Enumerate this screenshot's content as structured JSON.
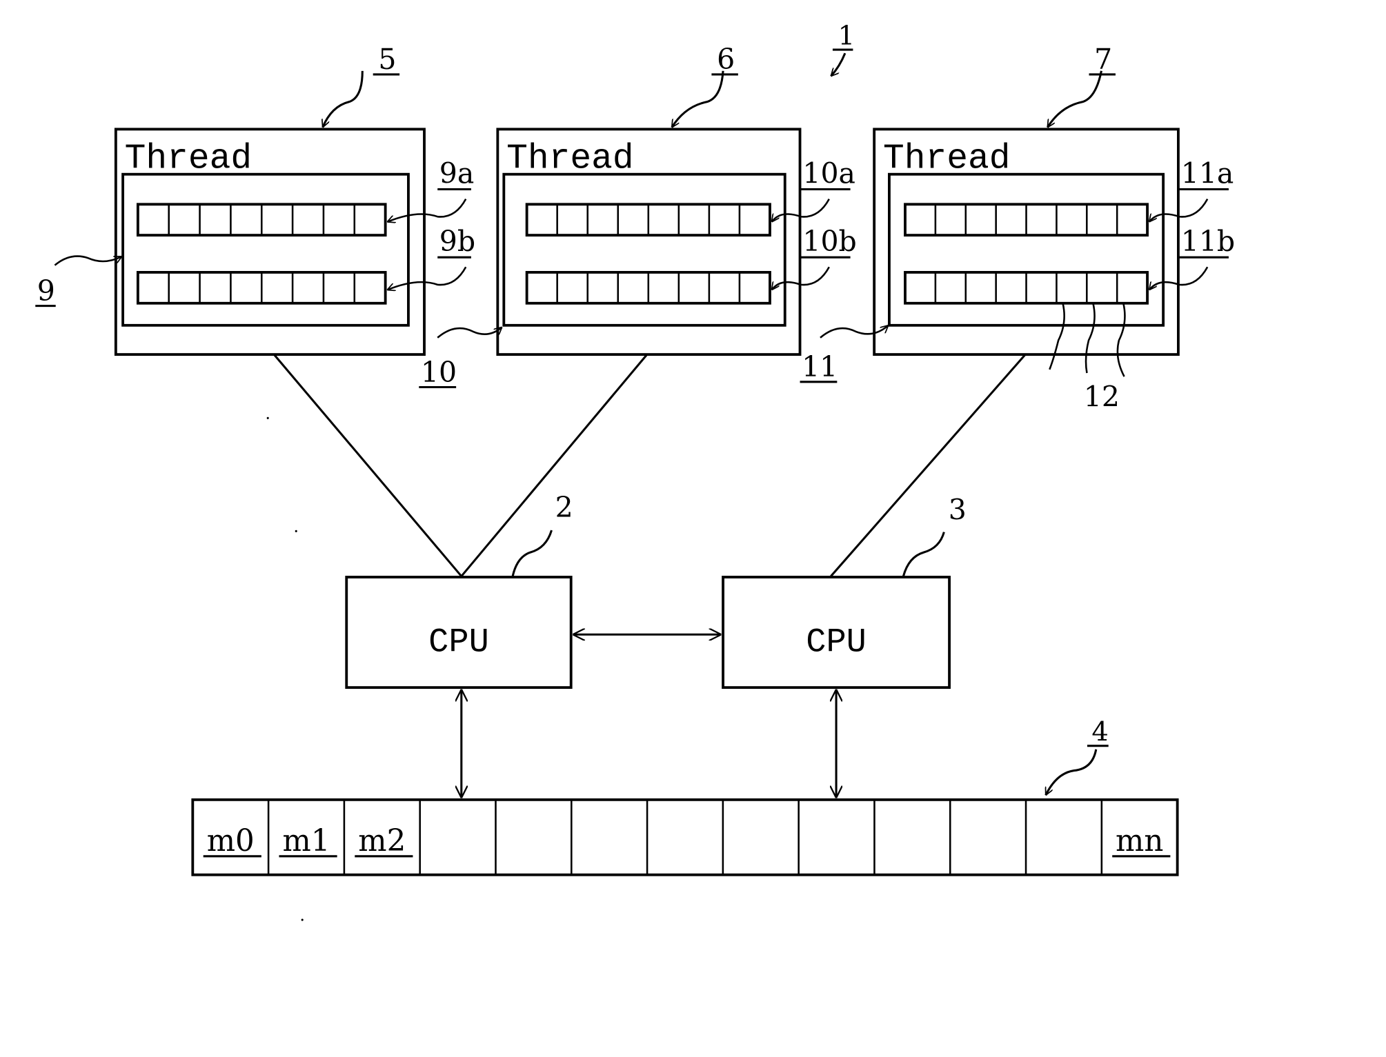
{
  "diagram": {
    "system_ref": "1",
    "threads": [
      {
        "ref": "5",
        "title": "Thread",
        "register_set_ref": "9",
        "rows": [
          {
            "ref": "9a",
            "cells": 8
          },
          {
            "ref": "9b",
            "cells": 8
          }
        ]
      },
      {
        "ref": "6",
        "title": "Thread",
        "register_set_ref": "10",
        "rows": [
          {
            "ref": "10a",
            "cells": 8
          },
          {
            "ref": "10b",
            "cells": 8
          }
        ]
      },
      {
        "ref": "7",
        "title": "Thread",
        "register_set_ref": "11",
        "rows": [
          {
            "ref": "11a",
            "cells": 8
          },
          {
            "ref": "11b",
            "cells": 8
          }
        ],
        "cell_ref": "12"
      }
    ],
    "cpus": [
      {
        "ref": "2",
        "label": "CPU"
      },
      {
        "ref": "3",
        "label": "CPU"
      }
    ],
    "memory": {
      "ref": "4",
      "cells": [
        "m0",
        "m1",
        "m2",
        "",
        "",
        "",
        "",
        "",
        "",
        "",
        "",
        "",
        "mn"
      ]
    }
  }
}
